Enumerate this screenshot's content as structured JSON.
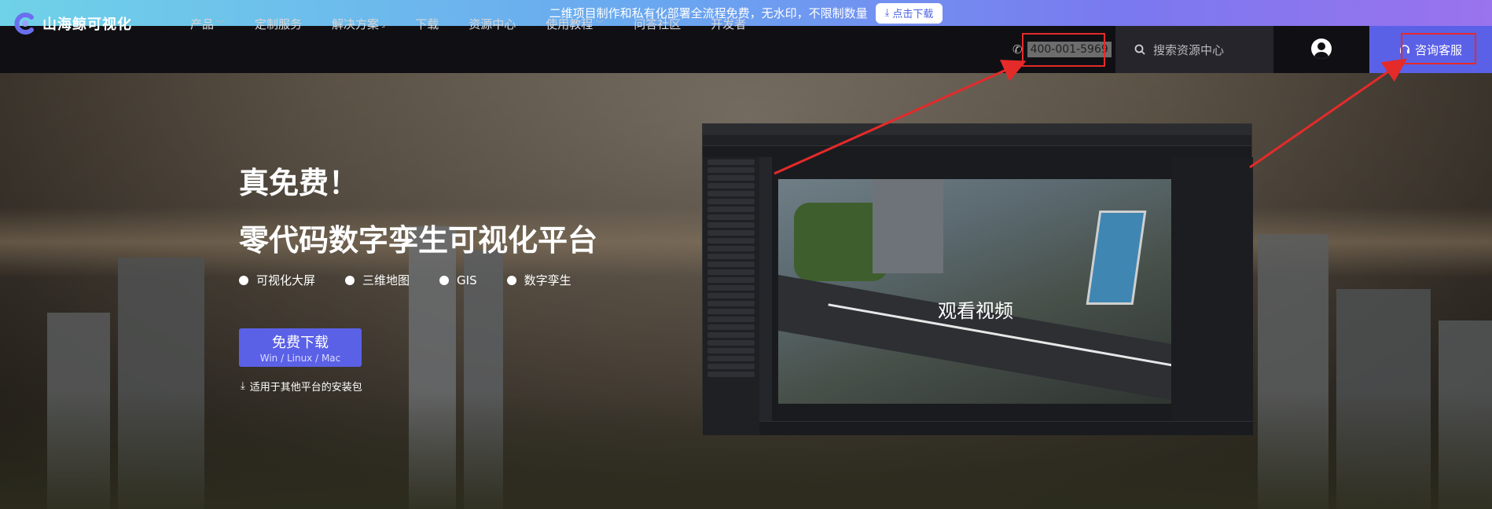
{
  "promo": {
    "text": "二维项目制作和私有化部署全流程免费，无水印，不限制数量",
    "button_label": "点击下载"
  },
  "nav": {
    "logo_text": "山海鲸可视化",
    "items": [
      {
        "label": "产品",
        "has_dropdown": true
      },
      {
        "label": "定制服务",
        "has_dropdown": false
      },
      {
        "label": "解决方案",
        "has_dropdown": false
      },
      {
        "label": "下载",
        "has_dropdown": false
      },
      {
        "label": "资源中心",
        "has_dropdown": false
      },
      {
        "label": "使用教程",
        "has_dropdown": true
      },
      {
        "label": "问答社区",
        "has_dropdown": false
      },
      {
        "label": "开发者",
        "has_dropdown": false
      }
    ],
    "phone": "400-001-5969",
    "search_placeholder": "搜索资源中心",
    "consult_label": "咨询客服"
  },
  "hero": {
    "title_line1": "真免费！",
    "title_line2": "零代码数字孪生可视化平台",
    "features": [
      "可视化大屏",
      "三维地图",
      "GIS",
      "数字孪生"
    ],
    "download_label": "免费下载",
    "download_sub": "Win / Linux / Mac",
    "other_platforms": "适用于其他平台的安装包",
    "video_overlay": "观看视频"
  },
  "colors": {
    "accent": "#5b61e6",
    "annotation_red": "#e52a2a",
    "nav_bg": "#101014"
  },
  "icons": [
    "download-icon",
    "phone-icon",
    "search-icon",
    "user-icon",
    "headset-icon",
    "chevron-down-icon"
  ]
}
